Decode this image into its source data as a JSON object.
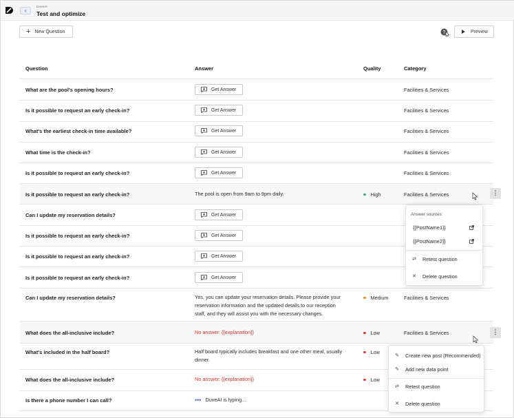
{
  "header": {
    "brand": "DuveAI",
    "title": "Test and optimize",
    "back_icon": "chevron-left-icon"
  },
  "toolbar": {
    "new_question_label": "New Question",
    "preview_label": "Preview"
  },
  "table": {
    "columns": [
      "Question",
      "Answer",
      "Quality",
      "Category"
    ],
    "get_answer_label": "Get Answer",
    "rows": [
      {
        "question": "What are the pool's opening hours?",
        "answer_type": "button",
        "quality": "",
        "category": "Facilities & Services"
      },
      {
        "question": "Is it possible to request an early check-in?",
        "answer_type": "button",
        "quality": "",
        "category": "Facilities & Services"
      },
      {
        "question": "What's the earliest check-in time available?",
        "answer_type": "button",
        "quality": "",
        "category": "Facilities & Services"
      },
      {
        "question": "What time is the check-in?",
        "answer_type": "button",
        "quality": "",
        "category": "Facilities & Services"
      },
      {
        "question": "Is it possible to request an early check-in?",
        "answer_type": "button",
        "quality": "",
        "category": "Facilities & Services"
      },
      {
        "question": "Is it possible to request an early check-in?",
        "answer_type": "text",
        "answer": "The pool is open from 9am to 9pm daily.",
        "quality": "High",
        "quality_color": "#2fb36b",
        "category": "Facilities & Services"
      },
      {
        "question": "Can I update my reservation details?",
        "answer_type": "button",
        "quality": "",
        "category": ""
      },
      {
        "question": "Is it possible to request an early check-in?",
        "answer_type": "button",
        "quality": "",
        "category": ""
      },
      {
        "question": "Is it possible to request an early check-in?",
        "answer_type": "button",
        "quality": "",
        "category": ""
      },
      {
        "question": "Is it possible to request an early check-in?",
        "answer_type": "button",
        "quality": "",
        "category": ""
      },
      {
        "question": "Can I update my reservation details?",
        "answer_type": "text",
        "answer_lines": [
          "Yes, you can update your reservation details. Please provide your",
          "reservation information and the updated details to our reception",
          "staff, and they will assist you with the necessary changes."
        ],
        "quality": "Medium",
        "quality_color": "#f08a24",
        "category": "Facilities & Services"
      },
      {
        "question": "What does the all-inclusive include?",
        "answer_type": "error",
        "answer": "No answer: {{explanation}}",
        "quality": "Low",
        "quality_color": "#e53935",
        "category": "Facilities & Services"
      },
      {
        "question": "What's included in the half board?",
        "answer_type": "text",
        "answer_lines": [
          "Half board typically includes breakfast and one other meal, usually",
          "dinner."
        ],
        "quality": "Low",
        "quality_color": "#e53935",
        "category": ""
      },
      {
        "question": "What does the all-inclusive include?",
        "answer_type": "error",
        "answer": "No answer: {{explanation}}",
        "quality": "Low",
        "quality_color": "#e53935",
        "category": ""
      },
      {
        "question": "Is there a phone number I can call?",
        "answer_type": "typing",
        "answer": "DuveAI is typing...",
        "quality": "",
        "category": ""
      }
    ]
  },
  "menu_sources": {
    "heading": "Answer sources:",
    "sources": [
      "{{PostName1}}",
      "{{PostName2}}"
    ],
    "retest_label": "Retest question",
    "delete_label": "Delete question"
  },
  "menu_actions": {
    "create_post_label": "Create new post (Recommended)",
    "add_data_point_label": "Add new data point",
    "retest_label": "Retest question",
    "delete_label": "Delete question"
  }
}
